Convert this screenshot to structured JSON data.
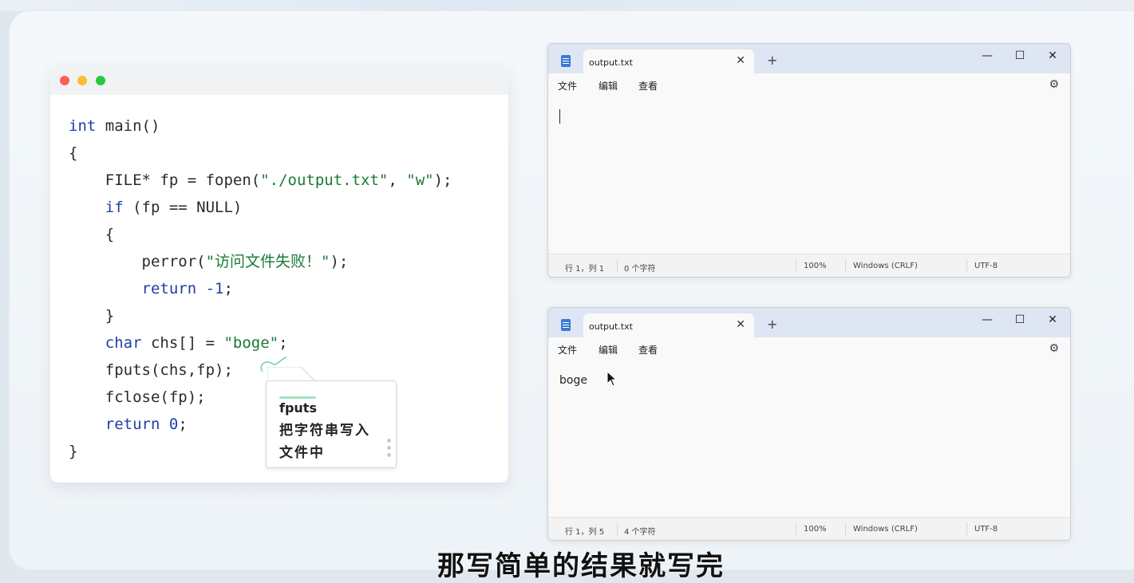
{
  "code_card": {
    "lines": [
      [
        {
          "t": "int",
          "c": "kw"
        },
        {
          "t": " main()",
          "c": ""
        }
      ],
      [
        {
          "t": "{",
          "c": ""
        }
      ],
      [
        {
          "t": "    FILE* fp = fopen(",
          "c": ""
        },
        {
          "t": "\"./output.txt\"",
          "c": "str"
        },
        {
          "t": ", ",
          "c": ""
        },
        {
          "t": "\"w\"",
          "c": "str"
        },
        {
          "t": ");",
          "c": ""
        }
      ],
      [
        {
          "t": "    ",
          "c": ""
        },
        {
          "t": "if",
          "c": "kw"
        },
        {
          "t": " (fp == NULL)",
          "c": ""
        }
      ],
      [
        {
          "t": "    {",
          "c": ""
        }
      ],
      [
        {
          "t": "        perror(",
          "c": ""
        },
        {
          "t": "\"访问文件失败！\"",
          "c": "str"
        },
        {
          "t": ");",
          "c": ""
        }
      ],
      [
        {
          "t": "        ",
          "c": ""
        },
        {
          "t": "return",
          "c": "kw"
        },
        {
          "t": " ",
          "c": ""
        },
        {
          "t": "-1",
          "c": "num"
        },
        {
          "t": ";",
          "c": ""
        }
      ],
      [
        {
          "t": "    }",
          "c": ""
        }
      ],
      [
        {
          "t": "    ",
          "c": ""
        },
        {
          "t": "char",
          "c": "kw"
        },
        {
          "t": " chs[] = ",
          "c": ""
        },
        {
          "t": "\"boge\"",
          "c": "str"
        },
        {
          "t": ";",
          "c": ""
        }
      ],
      [
        {
          "t": "    fputs(chs,fp);",
          "c": ""
        }
      ],
      [
        {
          "t": "    fclose(fp);",
          "c": ""
        }
      ],
      [
        {
          "t": "    ",
          "c": ""
        },
        {
          "t": "return",
          "c": "kw"
        },
        {
          "t": " ",
          "c": ""
        },
        {
          "t": "0",
          "c": "num"
        },
        {
          "t": ";",
          "c": ""
        }
      ],
      [
        {
          "t": "}",
          "c": ""
        }
      ]
    ]
  },
  "tooltip": {
    "title": "fputs",
    "description": "把字符串写入文件中"
  },
  "notepad_top": {
    "tab_label": "output.txt",
    "close_glyph": "✕",
    "new_tab_glyph": "+",
    "minimize_glyph": "—",
    "maximize_glyph": "☐",
    "window_close_glyph": "✕",
    "menu": [
      "文件",
      "编辑",
      "查看"
    ],
    "gear_glyph": "⚙",
    "content": "",
    "status": {
      "position": "行 1，列 1",
      "chars": "0 个字符",
      "zoom": "100%",
      "eol": "Windows (CRLF)",
      "encoding": "UTF-8"
    }
  },
  "notepad_bottom": {
    "tab_label": "output.txt",
    "close_glyph": "✕",
    "new_tab_glyph": "+",
    "minimize_glyph": "—",
    "maximize_glyph": "☐",
    "window_close_glyph": "✕",
    "menu": [
      "文件",
      "编辑",
      "查看"
    ],
    "gear_glyph": "⚙",
    "content": "boge",
    "status": {
      "position": "行 1，列 5",
      "chars": "4 个字符",
      "zoom": "100%",
      "eol": "Windows (CRLF)",
      "encoding": "UTF-8"
    }
  },
  "subtitle": "那写简单的结果就写完"
}
